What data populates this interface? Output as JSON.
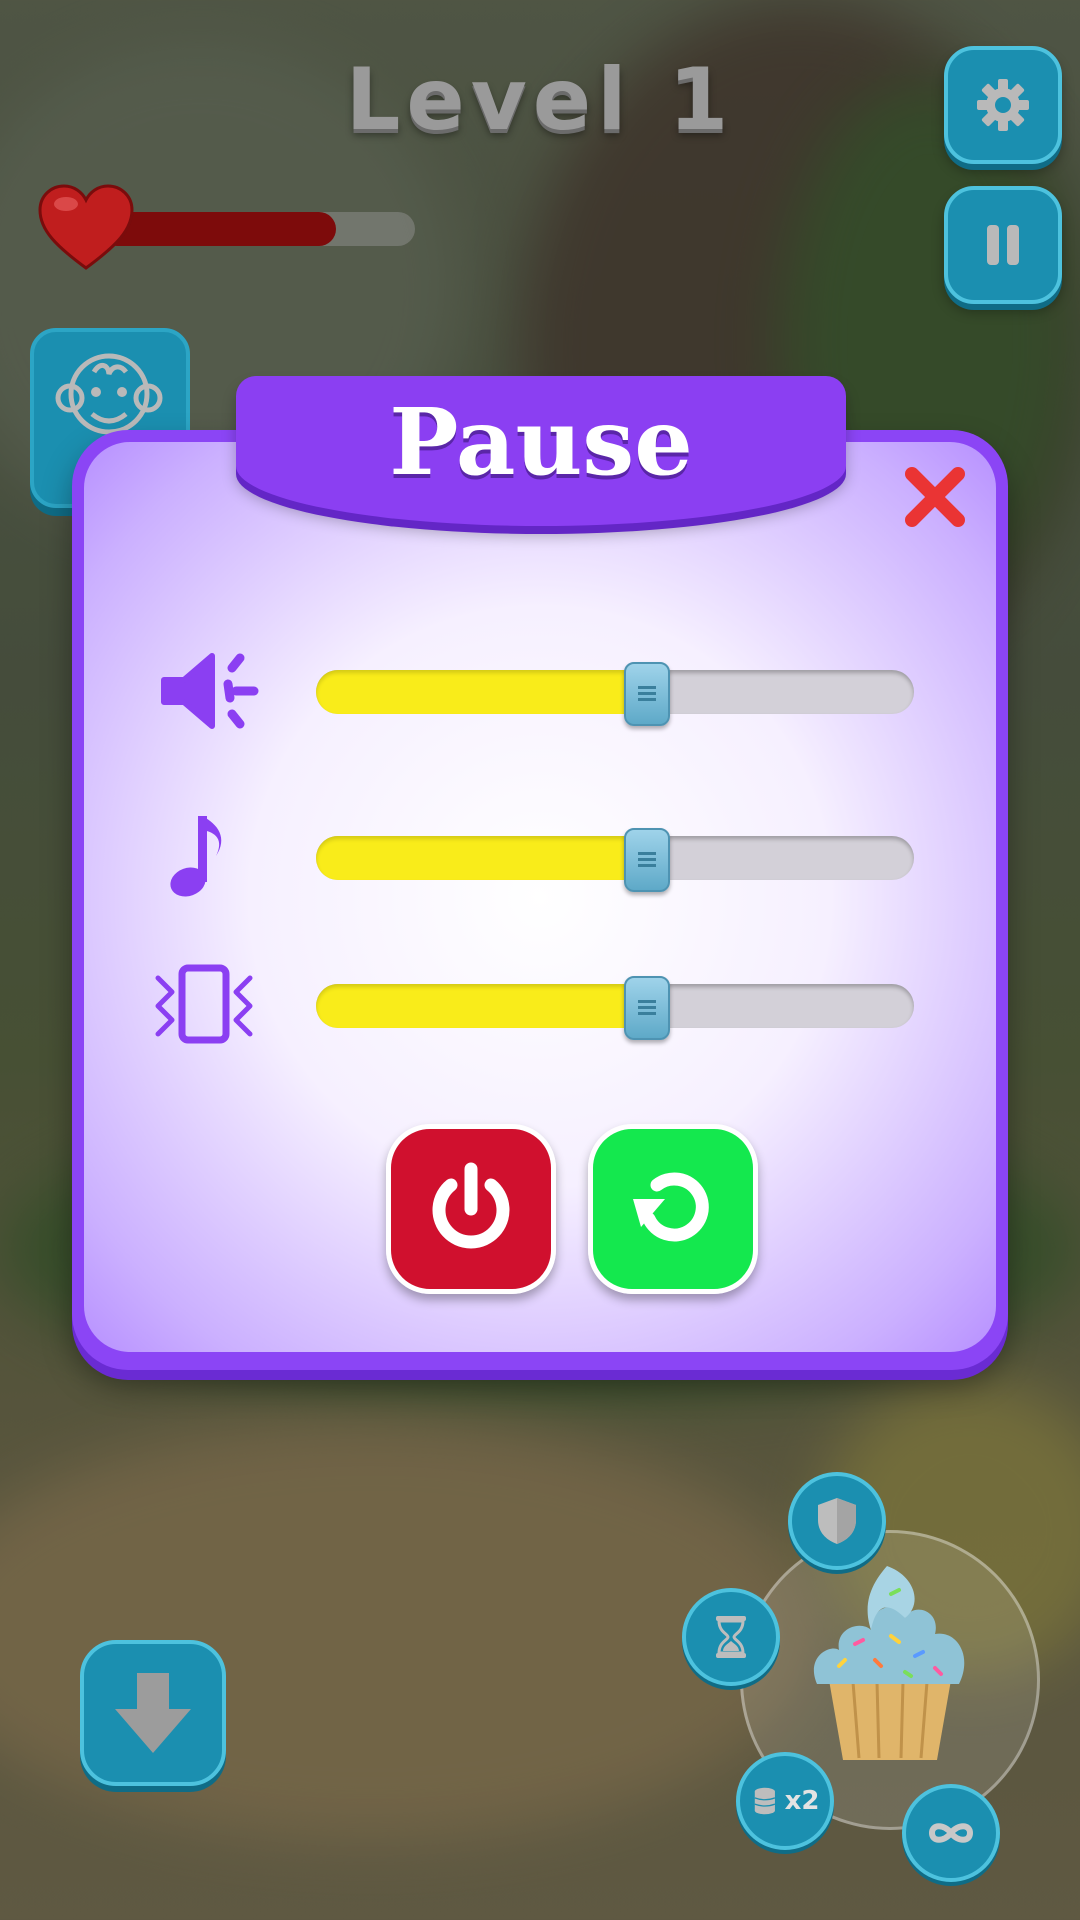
{
  "hud": {
    "level_title": "Level 1",
    "health_fraction": 0.75
  },
  "pause_dialog": {
    "title": "Pause",
    "sliders": [
      {
        "icon": "speaker-volume-icon",
        "value": 0.55
      },
      {
        "icon": "music-note-icon",
        "value": 0.55
      },
      {
        "icon": "vibration-icon",
        "value": 0.55
      }
    ],
    "buttons": [
      {
        "icon": "power-icon",
        "color": "#d0102e"
      },
      {
        "icon": "restart-icon",
        "color": "#14e84e"
      }
    ]
  },
  "powerups": {
    "multiplier_label": "x2"
  },
  "colors": {
    "accent_purple": "#8b45f5",
    "hud_blue": "#1b8fb0",
    "slider_fill": "#f9ec1a",
    "close_red": "#ea3434"
  }
}
